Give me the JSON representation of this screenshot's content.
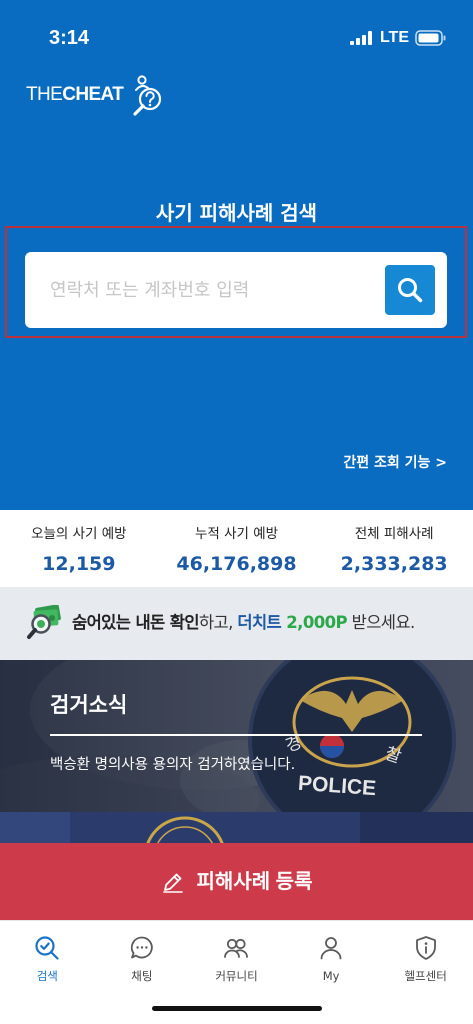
{
  "status_bar": {
    "time": "3:14",
    "network": "LTE",
    "signal_icon": "signal-bars-icon",
    "battery_icon": "battery-icon"
  },
  "logo": {
    "part1": "THE",
    "part2": "CHEAT",
    "icon": "magnifier-question-icon"
  },
  "hero": {
    "title": "사기 피해사례 검색",
    "search": {
      "value": "",
      "placeholder": "연락처 또는 계좌번호 입력",
      "button_icon": "search-icon"
    },
    "quick_lookup_label": "간편 조회 기능 >"
  },
  "stats": [
    {
      "label": "오늘의 사기 예방",
      "value": "12,159"
    },
    {
      "label": "누적 사기 예방",
      "value": "46,176,898"
    },
    {
      "label": "전체 피해사례",
      "value": "2,333,283"
    }
  ],
  "banner": {
    "icon": "money-search-icon",
    "lead_bold": "숨어있는 내돈 확인",
    "connector": "하고, ",
    "brand": "더치트",
    "points": " 2,000P",
    "tail": " 받으세요."
  },
  "arrest_news": {
    "title": "검거소식",
    "headline": "백승환 명의사용 용의자 검거하였습니다.",
    "badge": {
      "left_char": "경",
      "right_char": "찰",
      "bottom_text": "POLICE"
    }
  },
  "register_button": {
    "label": "피해사례 등록",
    "icon": "pencil-icon"
  },
  "tab_bar": {
    "active_index": 0,
    "tabs": [
      {
        "label": "검색",
        "icon": "search-check-icon"
      },
      {
        "label": "채팅",
        "icon": "chat-bubble-icon"
      },
      {
        "label": "커뮤니티",
        "icon": "people-icon"
      },
      {
        "label": "My",
        "icon": "person-icon"
      },
      {
        "label": "헬프센터",
        "icon": "help-shield-icon"
      }
    ]
  },
  "colors": {
    "primary_blue": "#0a6cc0",
    "search_button": "#1688d4",
    "highlight_red": "#b8313c",
    "stat_number": "#1d5aa5",
    "banner_bg": "#e7eaee",
    "brand_blue": "#1d5aa5",
    "points_green": "#2ba84a",
    "register_red": "#cd3b4b",
    "tab_active": "#1a73c8"
  }
}
